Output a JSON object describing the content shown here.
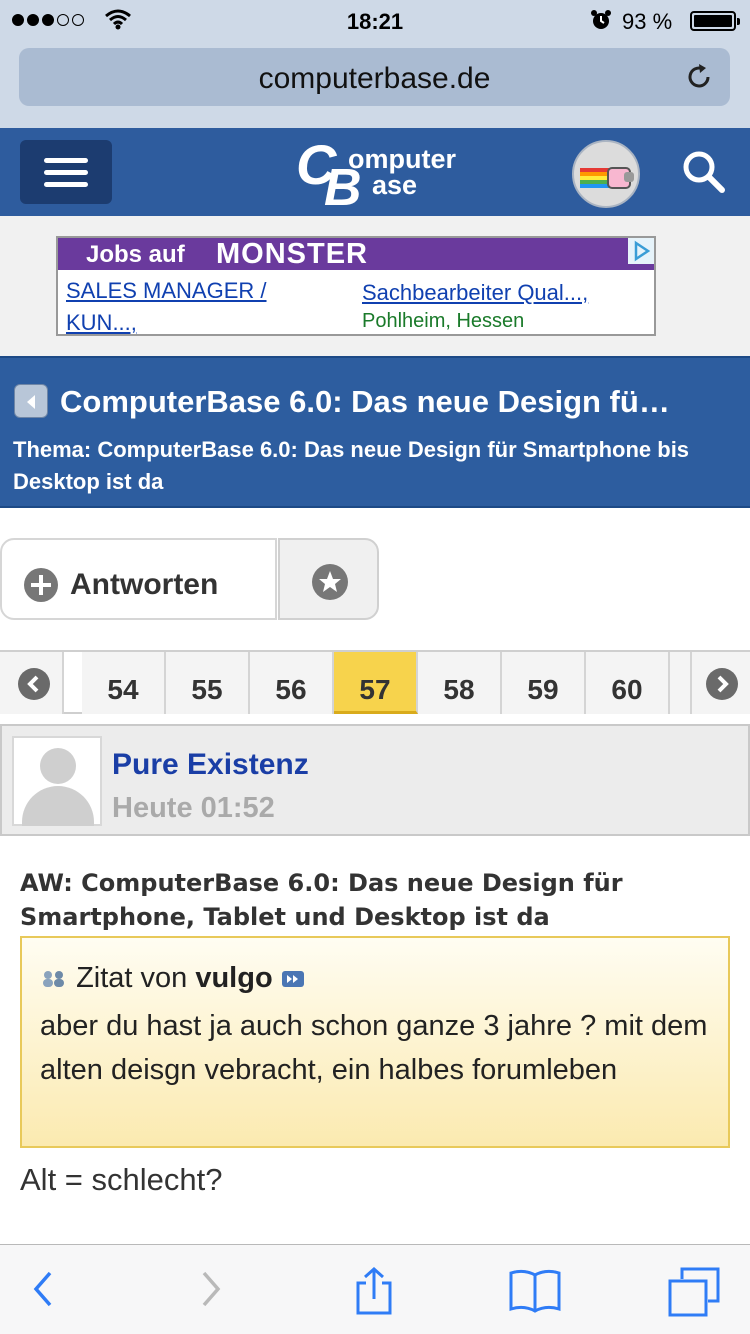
{
  "status_bar": {
    "time": "18:21",
    "battery_percent": "93 %",
    "signal_bars": 3,
    "icons": [
      "signal-dots-icon",
      "wifi-icon",
      "alarm-icon",
      "battery-icon"
    ]
  },
  "browser": {
    "url": "computerbase.de"
  },
  "site_header": {
    "logo_text_1": "omputer",
    "logo_text_2": "ase",
    "logo_initial_1": "C",
    "logo_initial_2": "B",
    "brand_color": "#2e5c9e"
  },
  "ad": {
    "jobs_label": "Jobs auf",
    "brand": "MONSTER",
    "link1_line1": "SALES MANAGER /",
    "link1_line2": "KUN...,",
    "link2": "Sachbearbeiter Qual...,",
    "location": "Pohlheim, Hessen"
  },
  "thread": {
    "title": "ComputerBase 6.0: Das neue Design fü…",
    "subtitle": "Thema: ComputerBase 6.0: Das neue Design für Smartphone bis Desktop ist da"
  },
  "actions": {
    "reply_label": "Antworten"
  },
  "pagination": {
    "pages": [
      "54",
      "55",
      "56",
      "57",
      "58",
      "59",
      "60"
    ],
    "current": "57",
    "active_color": "#f7d34c"
  },
  "post": {
    "username": "Pure Existenz",
    "date": "Heute 01:52",
    "title": "AW: ComputerBase 6.0: Das neue Design für Smartphone, Tablet und Desktop ist da",
    "quote_prefix": "Zitat von",
    "quote_author": "vulgo",
    "quote_text": "aber du hast ja auch schon ganze 3 jahre ? mit dem alten deisgn vebracht, ein halbes forumleben",
    "body": "Alt = schlecht?"
  }
}
